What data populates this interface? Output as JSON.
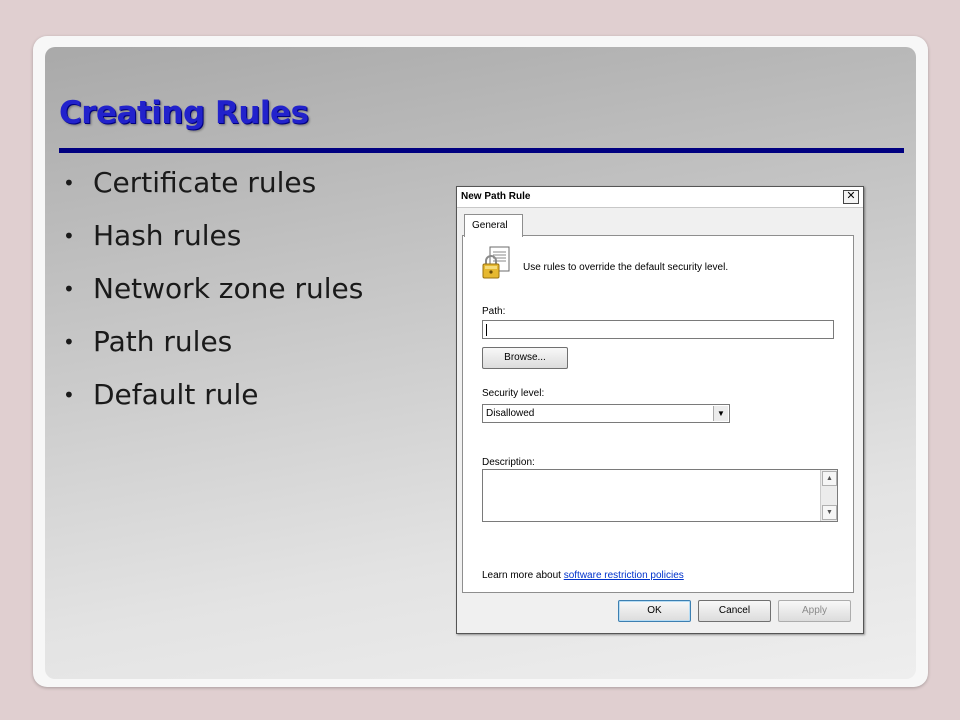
{
  "slide": {
    "title": "Creating Rules",
    "bullets": [
      "Certificate rules",
      "Hash rules",
      "Network zone rules",
      "Path rules",
      "Default rule"
    ],
    "bullet_char": "•"
  },
  "dialog": {
    "title": "New Path Rule",
    "close_symbol": "✕",
    "tab_label": "General",
    "intro_text": "Use rules to override the default security level.",
    "path_label": "Path:",
    "path_value": "",
    "browse_label": "Browse...",
    "security_level_label": "Security level:",
    "security_level_value": "Disallowed",
    "description_label": "Description:",
    "description_value": "",
    "learn_more_prefix": "Learn more about ",
    "learn_more_link": "software restriction policies",
    "ok_label": "OK",
    "cancel_label": "Cancel",
    "apply_label": "Apply"
  },
  "colors": {
    "title_color": "#2222cc",
    "rule_color": "#000080",
    "link_color": "#0033cc"
  }
}
